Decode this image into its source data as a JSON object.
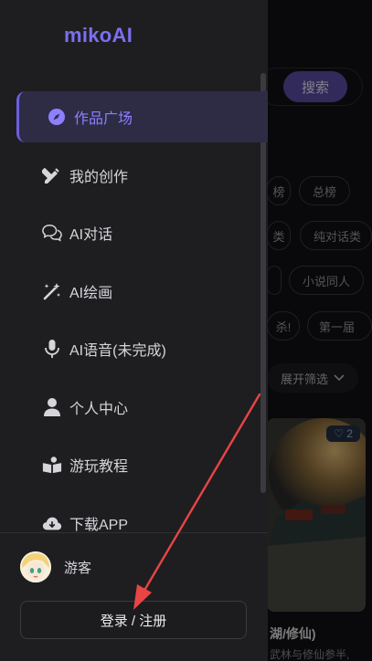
{
  "app": {
    "logo": "mikoAI"
  },
  "background": {
    "search_label": "搜索",
    "chips": [
      "榜",
      "总榜",
      "类",
      "纯对话类",
      "",
      "小说同人",
      "杀!",
      "第一届"
    ],
    "filter_label": "展开筛选",
    "card": {
      "likes": "2",
      "title": "湖/修仙)",
      "desc": "武林与修仙参半,"
    }
  },
  "sidebar": {
    "items": [
      {
        "label": "作品广场",
        "icon": "compass-icon",
        "active": true
      },
      {
        "label": "我的创作",
        "icon": "pen-ruler-icon",
        "active": false
      },
      {
        "label": "AI对话",
        "icon": "chat-bubbles-icon",
        "active": false
      },
      {
        "label": "AI绘画",
        "icon": "magic-wand-icon",
        "active": false
      },
      {
        "label": "AI语音(未完成)",
        "icon": "microphone-icon",
        "active": false
      },
      {
        "label": "个人中心",
        "icon": "person-icon",
        "active": false
      },
      {
        "label": "游玩教程",
        "icon": "book-reader-icon",
        "active": false
      },
      {
        "label": "下载APP",
        "icon": "cloud-download-icon",
        "active": false
      }
    ]
  },
  "user": {
    "name": "游客",
    "login_label": "登录 / 注册"
  },
  "colors": {
    "accent": "#7c6ff0",
    "active_bg": "#2e2b45",
    "arrow": "#e84545"
  }
}
